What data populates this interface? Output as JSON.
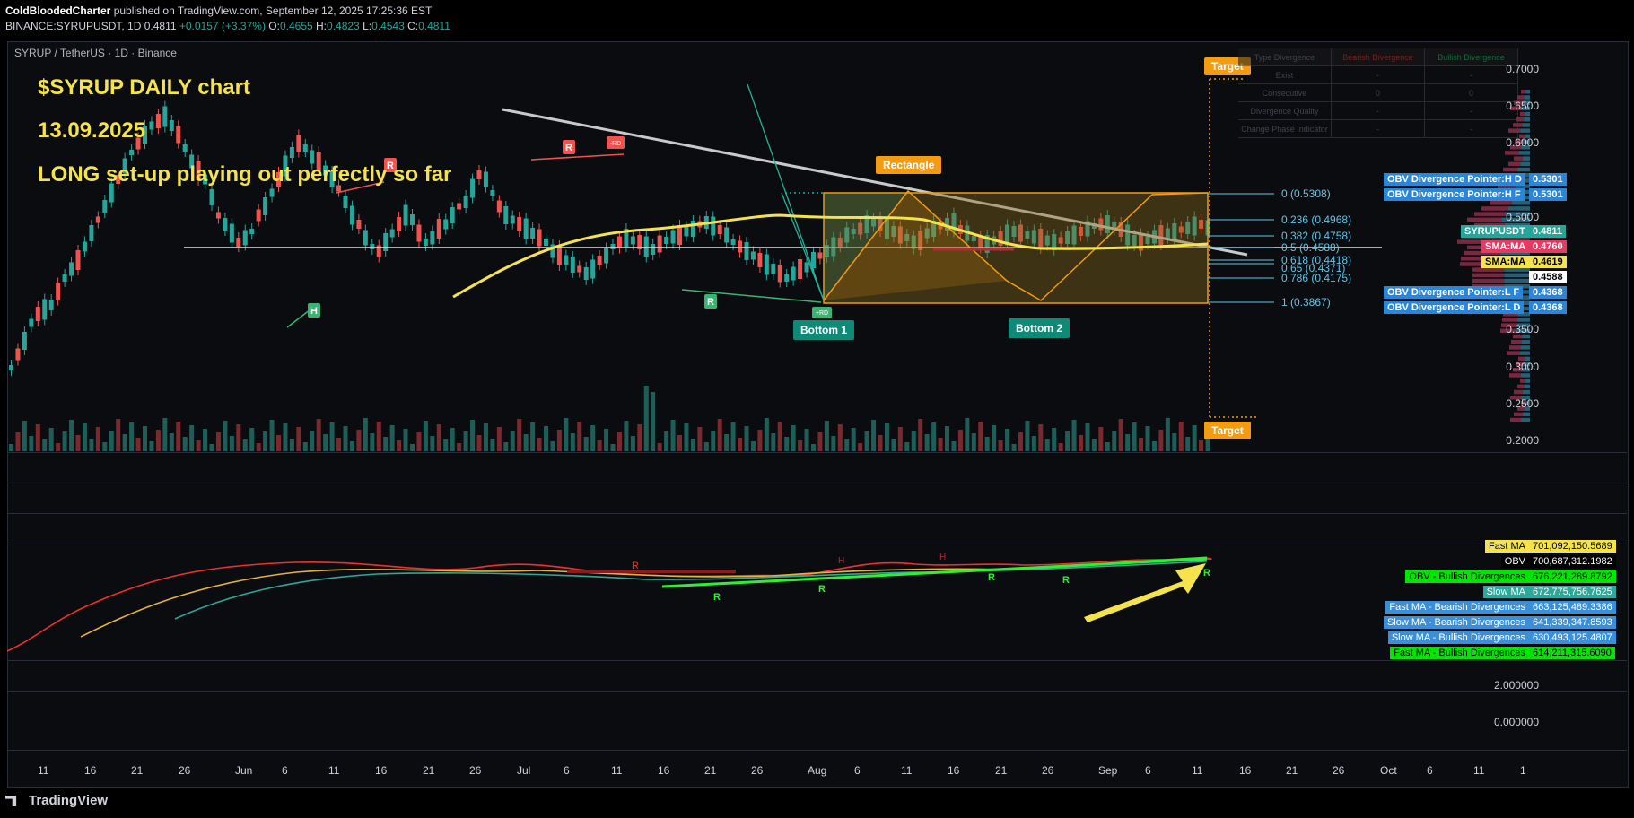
{
  "header": {
    "author": "ColdBloodedCharter",
    "published": "published on TradingView.com, September 12, 2025 17:25:36 EST",
    "symbol": "BINANCE:SYRUPUSDT, 1D",
    "last": "0.4811",
    "change": "+0.0157 (+3.37%)",
    "o_label": "O:",
    "o": "0.4655",
    "h_label": "H:",
    "h": "0.4823",
    "l_label": "L:",
    "l": "0.4543",
    "c_label": "C:",
    "c": "0.4811"
  },
  "chart_symbol": "SYRUP / TetherUS · 1D · Binance",
  "annotations": {
    "title_line1": "$SYRUP     DAILY chart",
    "date_line": "13.09.2025",
    "note_line": "LONG set-up playing out perfectly so far",
    "target_top": "Target",
    "target_bottom": "Target",
    "rectangle": "Rectangle",
    "bottom1": "Bottom 1",
    "bottom2": "Bottom 2"
  },
  "fib_levels": [
    {
      "label": "0 (0.5308)"
    },
    {
      "label": "0.236 (0.4968)"
    },
    {
      "label": "0.382 (0.4758)"
    },
    {
      "label": "0.5 (0.4588)"
    },
    {
      "label": "0.618 (0.4418)"
    },
    {
      "label": "0.65 (0.4371)"
    },
    {
      "label": "0.786 (0.4175)"
    },
    {
      "label": "1 (0.3867)"
    }
  ],
  "price_axis": [
    "0.7000",
    "0.6500",
    "0.6000",
    "0.5000",
    "0.3500",
    "0.3000",
    "0.2500",
    "0.2000"
  ],
  "price_tags": {
    "obv_hd_label": "OBV Divergence Pointer:H D",
    "obv_hd": "0.5301",
    "obv_hf_label": "OBV Divergence Pointer:H F",
    "obv_hf": "0.5301",
    "sym_label": "SYRUPUSDT",
    "sym": "0.4811",
    "sma_red_label": "SMA:MA",
    "sma_red": "0.4760",
    "sma_yel_label": "SMA:MA",
    "sma_yel": "0.4619",
    "fib_mid": "0.4588",
    "obv_lf_label": "OBV Divergence Pointer:L F",
    "obv_lf": "0.4368",
    "obv_ld_label": "OBV Divergence Pointer:L D",
    "obv_ld": "0.4368"
  },
  "div_table": {
    "headers": [
      "Type Divergence",
      "Bearish Divergence",
      "Bullish Divergence"
    ],
    "rows": [
      [
        "Exist",
        "-",
        "-"
      ],
      [
        "Consecutive",
        "0",
        "0"
      ],
      [
        "Divergence Quality",
        "-",
        "-"
      ],
      [
        "Change Phase Indicator",
        "-",
        "-"
      ]
    ]
  },
  "indicator_rows": [
    {
      "label": "Fast MA",
      "value": "701,092,150.5689",
      "color": "#f4e34d",
      "text": "#000"
    },
    {
      "label": "OBV",
      "value": "700,687,312.1982",
      "color": "#000000",
      "text": "#fff"
    },
    {
      "label": "OBV - Bullish Divergences",
      "value": "676,221,289.8792",
      "color": "#00e600",
      "text": "#000"
    },
    {
      "label": "Slow MA",
      "value": "672,775,756.7625",
      "color": "#2ea89a",
      "text": "#fff"
    },
    {
      "label": "Fast MA - Bearish Divergences",
      "value": "663,125,489.3386",
      "color": "#3b8fd9",
      "text": "#fff"
    },
    {
      "label": "Slow MA - Bearish Divergences",
      "value": "641,339,347.8593",
      "color": "#3b8fd9",
      "text": "#fff"
    },
    {
      "label": "Slow MA - Bullish Divergences",
      "value": "630,493,125.4807",
      "color": "#3b8fd9",
      "text": "#fff"
    },
    {
      "label": "Fast MA - Bullish Divergences",
      "value": "614,211,315.6090",
      "color": "#00e600",
      "text": "#000"
    }
  ],
  "lower_axis": [
    "2.000000",
    "0.000000"
  ],
  "time_axis": [
    "11",
    "16",
    "21",
    "26",
    "Jun",
    "6",
    "11",
    "16",
    "21",
    "26",
    "Jul",
    "6",
    "11",
    "16",
    "21",
    "26",
    "Aug",
    "6",
    "11",
    "16",
    "21",
    "26",
    "Sep",
    "6",
    "11",
    "16",
    "21",
    "26",
    "Oct",
    "6",
    "11",
    "1"
  ],
  "chart_markers": {
    "h": "H",
    "r": "R",
    "plus_rd": "+RD",
    "minus_rd": "-RD"
  },
  "brand": "TradingView",
  "colors": {
    "up": "#26a69a",
    "down": "#ef5350",
    "sma_yellow": "#f4e34d",
    "fib": "#5fc6e8",
    "target": "#f39c12"
  }
}
